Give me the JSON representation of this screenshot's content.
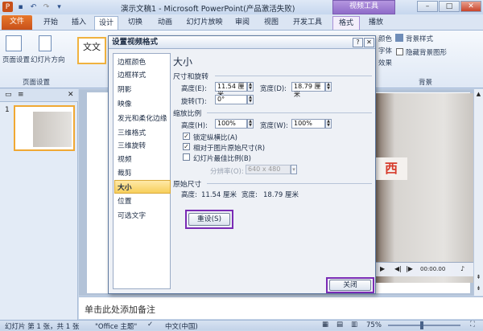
{
  "title_bar": {
    "app_title": "演示文稿1 - Microsoft PowerPoint(产品激活失败)",
    "contextual_group": "视频工具",
    "minimize": "–",
    "maximize": "□",
    "close": "✕"
  },
  "tabs": [
    "文件",
    "开始",
    "插入",
    "设计",
    "切换",
    "动画",
    "幻灯片放映",
    "审阅",
    "视图",
    "开发工具",
    "格式",
    "播放"
  ],
  "ribbon": {
    "page_setup": "页面设置",
    "orientation": "幻灯片方向",
    "group_page_setup": "页面设置",
    "theme_label": "文文",
    "colors": "颜色",
    "fonts": "字体",
    "effects": "效果",
    "bg_styles": "背景样式",
    "hide_bg": "隐藏背景图形",
    "group_background": "背景"
  },
  "dialog": {
    "title": "设置视频格式",
    "help": "?",
    "close": "✕",
    "nav": [
      "边框颜色",
      "边框样式",
      "阴影",
      "映像",
      "发光和柔化边缘",
      "三维格式",
      "三维旋转",
      "视频",
      "裁剪",
      "大小",
      "位置",
      "可选文字"
    ],
    "selected_nav": "大小",
    "heading": "大小",
    "section_size": "尺寸和旋转",
    "height_label": "高度(E):",
    "height_value": "11.54 厘米",
    "width_label": "宽度(D):",
    "width_value": "18.79 厘米",
    "rotation_label": "旋转(T):",
    "rotation_value": "0°",
    "section_scale": "缩放比例",
    "scale_height_label": "高度(H):",
    "scale_height_value": "100%",
    "scale_width_label": "宽度(W):",
    "scale_width_value": "100%",
    "lock_aspect": "锁定纵横比(A)",
    "relative_original": "相对于图片原始尺寸(R)",
    "best_scale": "幻灯片最佳比例(B)",
    "resolution_label": "分辨率(O):",
    "resolution_value": "640 x 480",
    "section_original": "原始尺寸",
    "original_height_label": "高度:",
    "original_height_value": "11.54 厘米",
    "original_width_label": "宽度:",
    "original_width_value": "18.79 厘米",
    "reset_button": "重设(S)",
    "close_button": "关闭"
  },
  "slide_panel": {
    "outline_tab": "≡",
    "slides_tab": "▭",
    "slide_number": "1"
  },
  "video_controls": {
    "time": "00:00.00"
  },
  "notes_placeholder": "单击此处添加备注",
  "status": {
    "slide_info": "幻灯片 第 1 张，共 1 张",
    "theme": "\"Office 主题\"",
    "language": "中文(中国)",
    "zoom": "75%"
  }
}
